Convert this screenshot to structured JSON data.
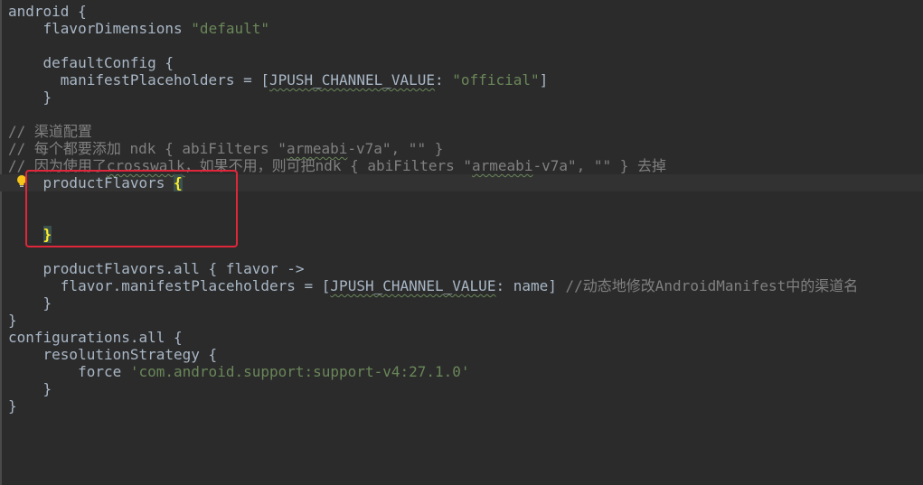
{
  "editor": {
    "lines": [
      "android {",
      "    flavorDimensions \"default\"",
      "",
      "    defaultConfig {",
      "      manifestPlaceholders = [JPUSH_CHANNEL_VALUE: \"official\"]",
      "    }",
      "",
      "// 渠道配置",
      "// 每个都要添加 ndk { abiFilters \"armeabi-v7a\", \"\" }",
      "// 因为使用了crosswalk，如果不用，则可把ndk { abiFilters \"armeabi-v7a\", \"\" } 去掉",
      "    productFlavors {",
      "",
      "",
      "    }",
      "",
      "    productFlavors.all { flavor ->",
      "      flavor.manifestPlaceholders = [JPUSH_CHANNEL_VALUE: name] //动态地修改AndroidManifest中的渠道名",
      "    }",
      "}",
      "configurations.all {",
      "    resolutionStrategy {",
      "        force 'com.android.support:support-v4:27.1.0'",
      "    }",
      "}"
    ],
    "gutter_icons": [
      "lightbulb-icon"
    ],
    "colors": {
      "background": "#2b2b2b",
      "text": "#a9b7c6",
      "string": "#6a8759",
      "comment": "#808080",
      "brace_match": "#ffef28",
      "annotation_box": "#e0263a",
      "bulb": "#f5c518"
    }
  }
}
